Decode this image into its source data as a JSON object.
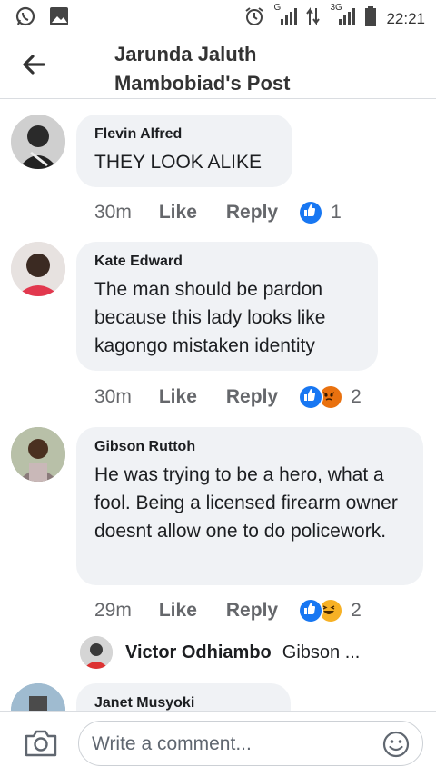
{
  "status_bar": {
    "time": "22:21",
    "network_1": "G",
    "network_2": "3G",
    "icons": [
      "whatsapp-icon",
      "gallery-icon",
      "alarm-icon",
      "signal-icon",
      "data-arrows-icon",
      "signal-icon",
      "battery-icon"
    ]
  },
  "header": {
    "title_line1": "Jarunda Jaluth",
    "title_line2": "Mambobiad's Post",
    "back_icon": "back-arrow-icon"
  },
  "comments": [
    {
      "author": "Flevin Alfred",
      "text": "THEY LOOK ALIKE",
      "time": "30m",
      "like_label": "Like",
      "reply_label": "Reply",
      "reaction_count": "1",
      "reactions": [
        "like-reaction-icon"
      ]
    },
    {
      "author": "Kate Edward",
      "text": "The man should be pardon because this lady looks like kagongo mistaken identity",
      "time": "30m",
      "like_label": "Like",
      "reply_label": "Reply",
      "reaction_count": "2",
      "reactions": [
        "like-reaction-icon",
        "angry-reaction-icon"
      ]
    },
    {
      "author": "Gibson Ruttoh",
      "text": "He was trying to be a hero, what a fool. Being a licensed firearm owner doesnt allow one to do policework.",
      "time": "29m",
      "like_label": "Like",
      "reply_label": "Reply",
      "reaction_count": "2",
      "reactions": [
        "like-reaction-icon",
        "haha-reaction-icon"
      ],
      "reply_preview": {
        "author": "Victor Odhiambo",
        "snippet": "Gibson ..."
      }
    },
    {
      "author": "Janet Musyoki"
    }
  ],
  "composer": {
    "placeholder": "Write a comment...",
    "camera_icon": "camera-icon",
    "emoji_icon": "emoji-icon"
  },
  "colors": {
    "bubble": "#f0f2f5",
    "meta_text": "#65676b",
    "like_blue": "#1877f2",
    "angry_orange": "#e9710f",
    "haha_yellow": "#f7b125"
  }
}
